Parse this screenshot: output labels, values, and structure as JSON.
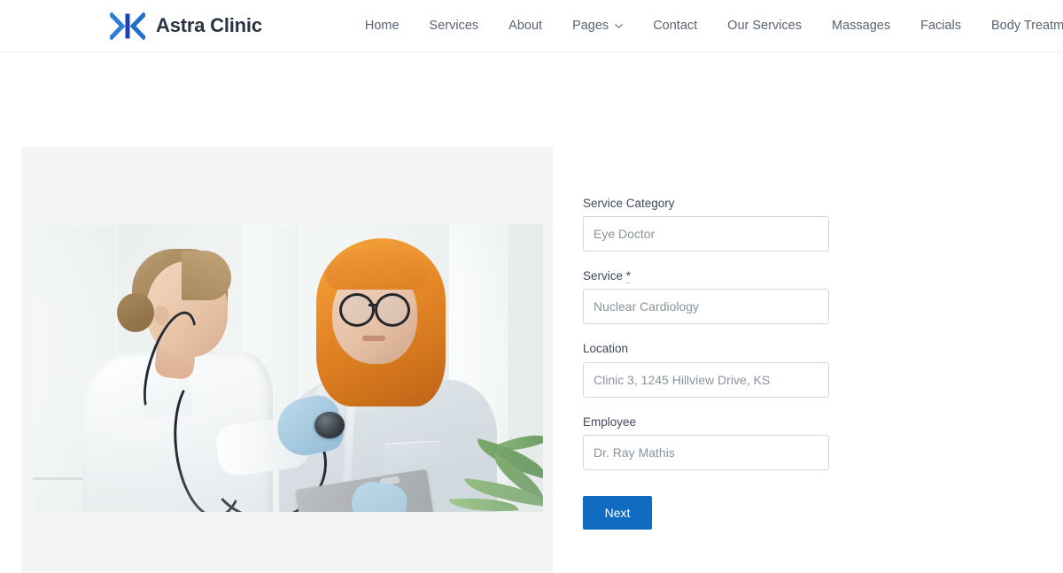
{
  "header": {
    "brand": {
      "name": "Astra Clinic",
      "logo_icon": "astra-chevrons-logo",
      "colors": {
        "chevron_left": "#2e7fd4",
        "bar": "#1f3fb5",
        "chevron_right": "#1f6fd0"
      }
    },
    "nav": [
      {
        "label": "Home",
        "has_dropdown": false
      },
      {
        "label": "Services",
        "has_dropdown": false
      },
      {
        "label": "About",
        "has_dropdown": false
      },
      {
        "label": "Pages",
        "has_dropdown": true,
        "dropdown_icon": "chevron-down-icon"
      },
      {
        "label": "Contact",
        "has_dropdown": false
      },
      {
        "label": "Our Services",
        "has_dropdown": false
      },
      {
        "label": "Massages",
        "has_dropdown": false
      },
      {
        "label": "Facials",
        "has_dropdown": false
      },
      {
        "label": "Body Treatments",
        "has_dropdown": false
      }
    ]
  },
  "booking": {
    "media": {
      "alt": "Doctor with stethoscope examining a patient in a clinic",
      "panel_background": "#f5f5f5"
    },
    "fields": [
      {
        "label": "Service Category",
        "required": false,
        "value": "Eye Doctor",
        "placeholder": "Eye Doctor",
        "name": "service-category"
      },
      {
        "label": "Service",
        "required": true,
        "required_mark": "*",
        "value": "Nuclear Cardiology",
        "placeholder": "Nuclear Cardiology",
        "name": "service"
      },
      {
        "label": "Location",
        "required": false,
        "value": "Clinic 3, 1245 Hillview Drive, KS",
        "placeholder": "Clinic 3, 1245 Hillview Drive, KS",
        "name": "location"
      },
      {
        "label": "Employee",
        "required": false,
        "value": "Dr. Ray Mathis",
        "placeholder": "Dr. Ray Mathis",
        "name": "employee"
      }
    ],
    "submit": {
      "label": "Next",
      "color": "#0f6cc0"
    }
  }
}
